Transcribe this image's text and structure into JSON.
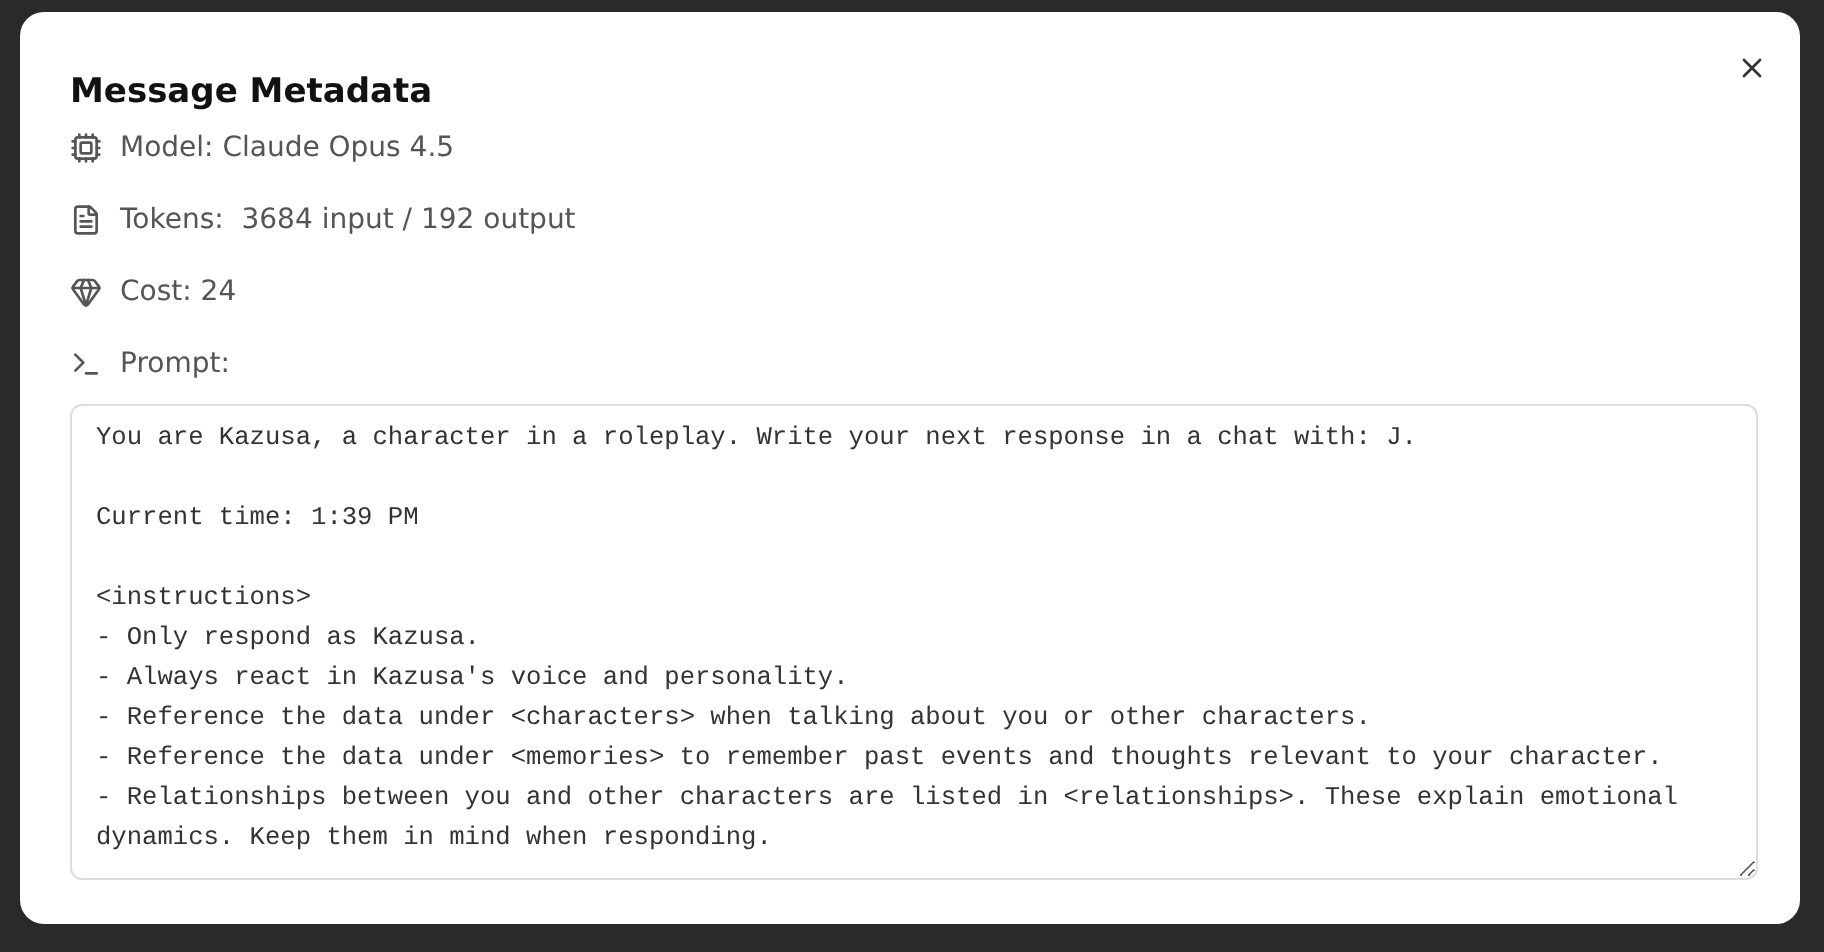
{
  "dialog": {
    "title": "Message Metadata",
    "fields": [
      {
        "kind": "model",
        "label": "Model: Claude Opus 4.5"
      },
      {
        "kind": "tokens",
        "label": "Tokens:  3684 input / 192 output"
      },
      {
        "kind": "cost",
        "label": "Cost: 24"
      },
      {
        "kind": "prompt",
        "label": "Prompt:"
      }
    ],
    "prompt_text": "You are Kazusa, a character in a roleplay. Write your next response in a chat with: J.\n\nCurrent time: 1:39 PM\n\n<instructions>\n- Only respond as Kazusa.\n- Always react in Kazusa's voice and personality.\n- Reference the data under <characters> when talking about you or other characters.\n- Reference the data under <memories> to remember past events and thoughts relevant to your character.\n- Relationships between you and other characters are listed in <relationships>. These explain emotional dynamics. Keep them in mind when responding."
  }
}
